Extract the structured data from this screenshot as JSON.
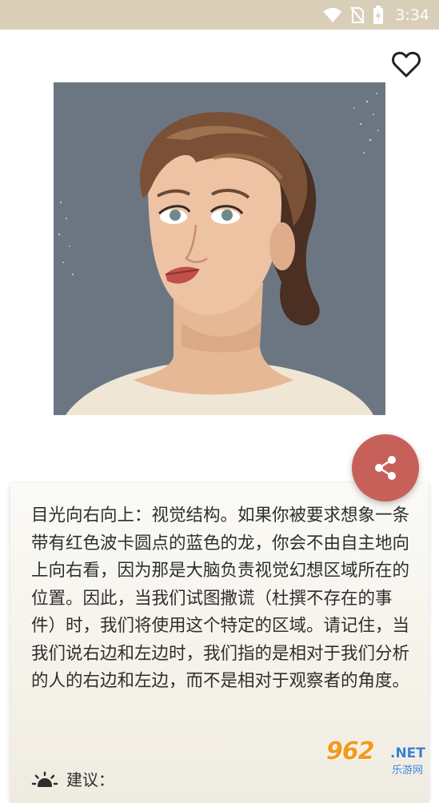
{
  "status_bar": {
    "time": "3:34",
    "icons": [
      "wifi-icon",
      "no-sim-icon",
      "battery-charging-icon"
    ]
  },
  "actions": {
    "favorite_icon": "heart-outline-icon",
    "share_icon": "share-icon"
  },
  "colors": {
    "status_bar_bg": "#d9cfb9",
    "fab": "#c8605a",
    "portrait_bg": "#6c7683"
  },
  "card": {
    "body": "目光向右向上：视觉结构。如果你被要求想象一条带有红色波卡圆点的蓝色的龙，你会不由自主地向上向右看，因为那是大脑负责视觉幻想区域所在的位置。因此，当我们试图撒谎（杜撰不存在的事件）时，我们将使用这个特定的区域。请记住，当我们说右边和左边时，我们指的是相对于我们分析的人的右边和左边，而不是相对于观察者的角度。",
    "suggestion_label": "建议：",
    "suggestion_icon": "lightbulb-icon"
  },
  "watermark": {
    "number": "962",
    "suffix": ".NET",
    "sub": "乐游网"
  }
}
